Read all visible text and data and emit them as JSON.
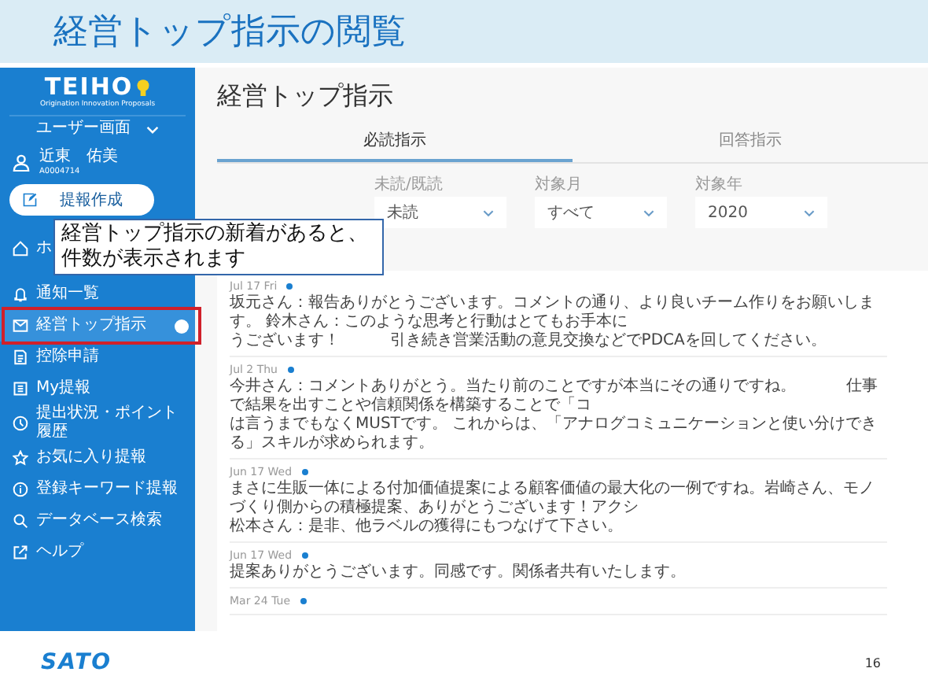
{
  "slide_title": "経営トップ指示の閲覧",
  "sidebar": {
    "logo": "TEIHO",
    "logo_tagline": "Origination Innovation Proposals",
    "view_switch": "ユーザー画面",
    "user": {
      "name": "近東　佑美",
      "id": "A0004714"
    },
    "create_button": "提報作成",
    "items": [
      {
        "label": "ホ",
        "selected": false,
        "badge": false,
        "highlighted": false
      },
      {
        "label": "通知一覧",
        "selected": false,
        "badge": false,
        "highlighted": false
      },
      {
        "label": "経営トップ指示",
        "selected": true,
        "badge": true,
        "highlighted": true
      },
      {
        "label": "控除申請",
        "selected": false,
        "badge": false,
        "highlighted": false
      },
      {
        "label": "My提報",
        "selected": false,
        "badge": false,
        "highlighted": false
      },
      {
        "label": "提出状況・ポイント履歴",
        "selected": false,
        "badge": false,
        "highlighted": false
      },
      {
        "label": "お気に入り提報",
        "selected": false,
        "badge": false,
        "highlighted": false
      },
      {
        "label": "登録キーワード提報",
        "selected": false,
        "badge": false,
        "highlighted": false
      },
      {
        "label": "データベース検索",
        "selected": false,
        "badge": false,
        "highlighted": false
      },
      {
        "label": "ヘルプ",
        "selected": false,
        "badge": false,
        "highlighted": false
      }
    ]
  },
  "callout": "経営トップ指示の新着があると、件数が表示されます",
  "main": {
    "title": "経営トップ指示",
    "tabs": [
      {
        "label": "必読指示",
        "selected": true
      },
      {
        "label": "回答指示",
        "selected": false
      }
    ],
    "filters": [
      {
        "label": "未読/既読",
        "value": "未読"
      },
      {
        "label": "対象月",
        "value": "すべて"
      },
      {
        "label": "対象年",
        "value": "2020"
      }
    ],
    "comments": [
      {
        "date": "Jul 17 Fri",
        "lines": [
          "坂元さん：報告ありがとうございます。コメントの通り、より良いチーム作りをお願いします。 鈴木さん：このような思考と行動はとてもお手本に",
          "うございます！          引き続き営業活動の意見交換などでPDCAを回してください。"
        ]
      },
      {
        "date": "Jul 2 Thu",
        "lines": [
          "今井さん：コメントありがとう。当たり前のことですが本当にその通りですね。          仕事で結果を出すことや信頼関係を構築することで「コ",
          "は言うまでもなくMUSTです。 これからは、「アナログコミュニケーションと使い分けできる」スキルが求められます。"
        ]
      },
      {
        "date": "Jun 17 Wed",
        "lines": [
          "まさに生販一体による付加価値提案による顧客価値の最大化の一例ですね。岩崎さん、モノづくり側からの積極提案、ありがとうございます！アクシ",
          "松本さん：是非、他ラベルの獲得にもつなげて下さい。"
        ]
      },
      {
        "date": "Jun 17 Wed",
        "lines": [
          "提案ありがとうございます。同感です。関係者共有いたします。"
        ]
      },
      {
        "date": "Mar 24 Tue"
      }
    ]
  },
  "footer": {
    "logo": "SATO",
    "page": "16"
  }
}
